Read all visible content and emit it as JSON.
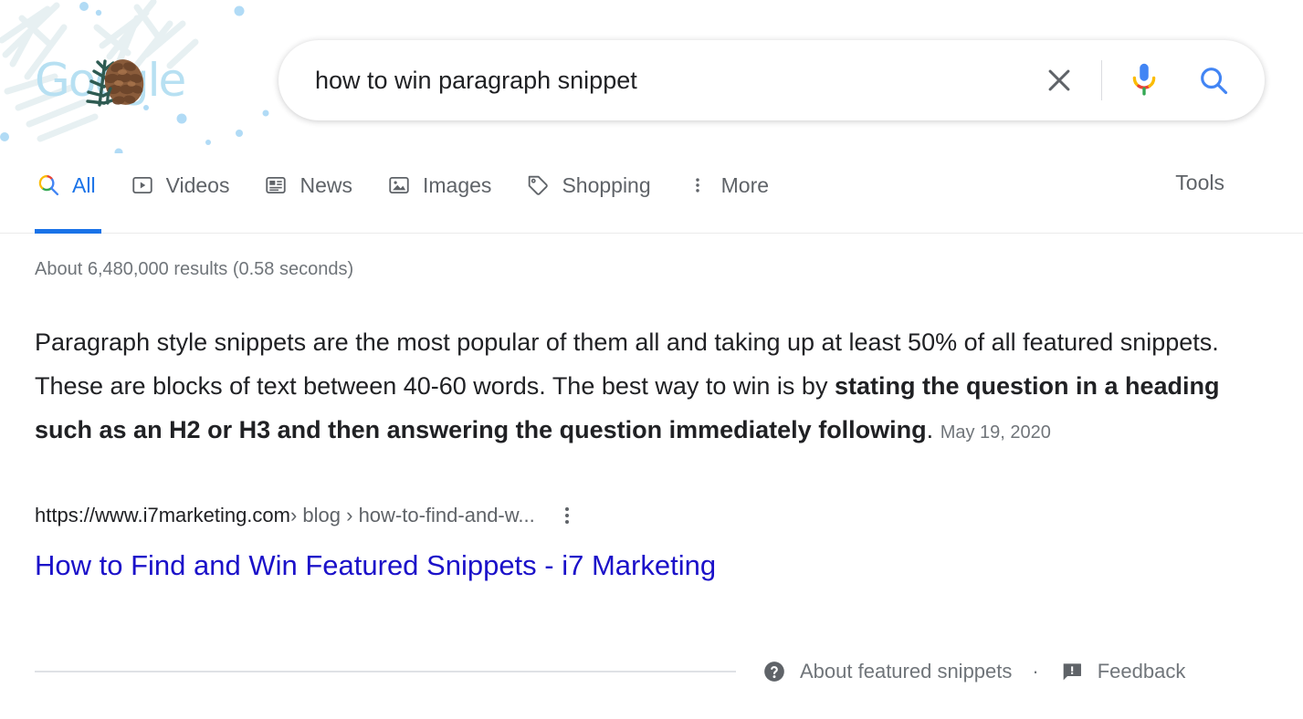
{
  "doodle": {
    "logo_text": "Google",
    "icon": "pinecone-doodle",
    "logo_color": "#b7e0f2",
    "theme": "winter-foliage"
  },
  "search": {
    "query": "how to win paragraph snippet",
    "placeholder": "Search",
    "clear_icon": "close-icon",
    "mic_icon": "microphone-icon",
    "search_icon": "search-icon"
  },
  "nav": {
    "tabs": [
      {
        "label": "All",
        "icon": "google-search-icon",
        "active": true
      },
      {
        "label": "Videos",
        "icon": "video-icon",
        "active": false
      },
      {
        "label": "News",
        "icon": "news-icon",
        "active": false
      },
      {
        "label": "Images",
        "icon": "image-icon",
        "active": false
      },
      {
        "label": "Shopping",
        "icon": "tag-icon",
        "active": false
      },
      {
        "label": "More",
        "icon": "more-vert-icon",
        "active": false
      }
    ],
    "tools_label": "Tools",
    "accent_color": "#1a73e8"
  },
  "results": {
    "stats": "About 6,480,000 results (0.58 seconds)",
    "featured_snippet": {
      "lead_text": "Paragraph style snippets are the most popular of them all and taking up at least 50% of all featured snippets. These are blocks of text between 40-60 words. The best way to win is by ",
      "bold_text": "stating the question in a heading such as an H2 or H3 and then answering the question immediately following",
      "tail_text": ".",
      "date": "May 19, 2020",
      "source_domain": "https://www.i7marketing.com",
      "source_path": " › blog › how-to-find-and-w...",
      "kebab_icon": "more-vert-icon",
      "title": "How to Find and Win Featured Snippets - i7 Marketing",
      "title_color": "#1b11c9"
    },
    "footer": {
      "about_icon": "help-circle-icon",
      "about_label": "About featured snippets",
      "separator": "·",
      "feedback_icon": "feedback-icon",
      "feedback_label": "Feedback"
    }
  }
}
